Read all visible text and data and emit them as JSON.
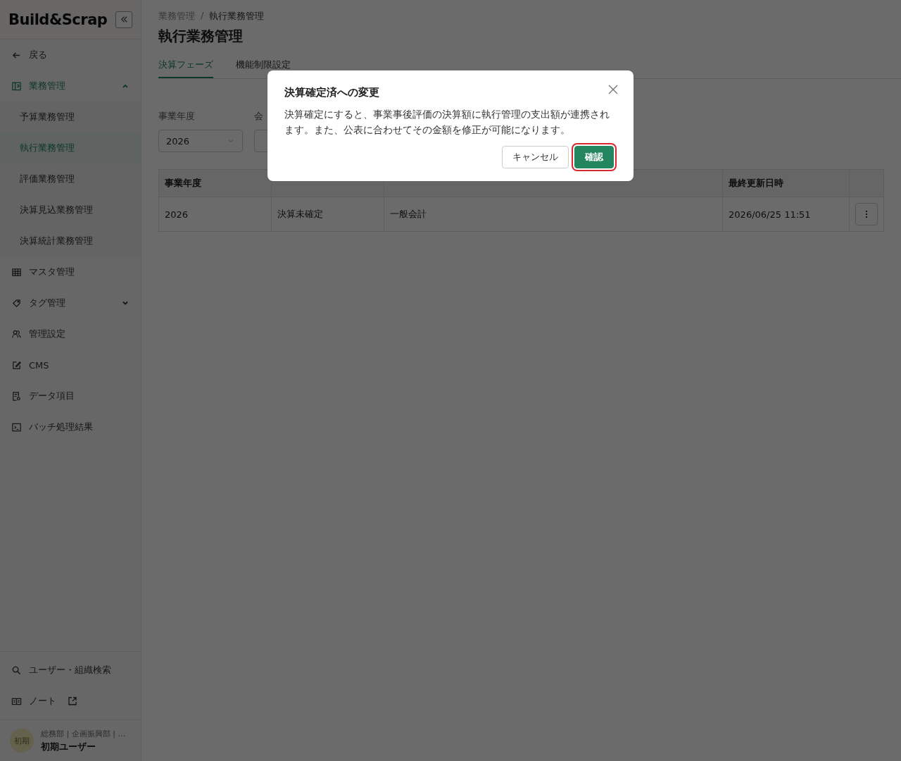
{
  "sidebar": {
    "logo": "Build&Scrap",
    "back": "戻る",
    "nav": [
      {
        "kind": "group",
        "label": "業務管理",
        "expanded": true,
        "children": [
          {
            "label": "予算業務管理",
            "selected": false
          },
          {
            "label": "執行業務管理",
            "selected": true
          },
          {
            "label": "評価業務管理",
            "selected": false
          },
          {
            "label": "決算見込業務管理",
            "selected": false
          },
          {
            "label": "決算統計業務管理",
            "selected": false
          }
        ]
      },
      {
        "kind": "link",
        "label": "マスタ管理"
      },
      {
        "kind": "group",
        "label": "タグ管理",
        "expanded": false
      },
      {
        "kind": "link",
        "label": "管理設定"
      },
      {
        "kind": "link",
        "label": "CMS"
      },
      {
        "kind": "link",
        "label": "データ項目"
      },
      {
        "kind": "link",
        "label": "バッチ処理結果"
      }
    ],
    "footer_nav": [
      {
        "kind": "link",
        "label": "ユーザー・組織検索"
      },
      {
        "kind": "external",
        "label": "ノート"
      }
    ],
    "user": {
      "avatar": "初期",
      "org": "総務部 | 企画振興部 | …",
      "name": "初期ユーザー"
    }
  },
  "main": {
    "breadcrumb": {
      "separator": "/",
      "items": [
        "業務管理",
        "執行業務管理"
      ]
    },
    "title": "執行業務管理",
    "tabs": [
      {
        "label": "決算フェーズ",
        "selected": true
      },
      {
        "label": "機能制限設定",
        "selected": false
      }
    ],
    "filters": [
      {
        "label": "事業年度",
        "value": "2026"
      },
      {
        "label": "会"
      }
    ],
    "table": {
      "columns": [
        "事業年度",
        null,
        null,
        "最終更新日時",
        null
      ],
      "rows": [
        {
          "cells": [
            "2026",
            "決算未確定",
            "一般会計",
            "2026/06/25 11:51"
          ]
        }
      ]
    }
  },
  "dialog": {
    "title": "決算確定済への変更",
    "message": "決算確定にすると、事業事後評価の決算額に執行管理の支出額が連携されます。また、公表に合わせてその金額を修正が可能になります。",
    "buttons": [
      {
        "label": "キャンセル",
        "kind": "secondary",
        "focused": false
      },
      {
        "label": "確認",
        "kind": "primary",
        "focused": true
      }
    ]
  }
}
